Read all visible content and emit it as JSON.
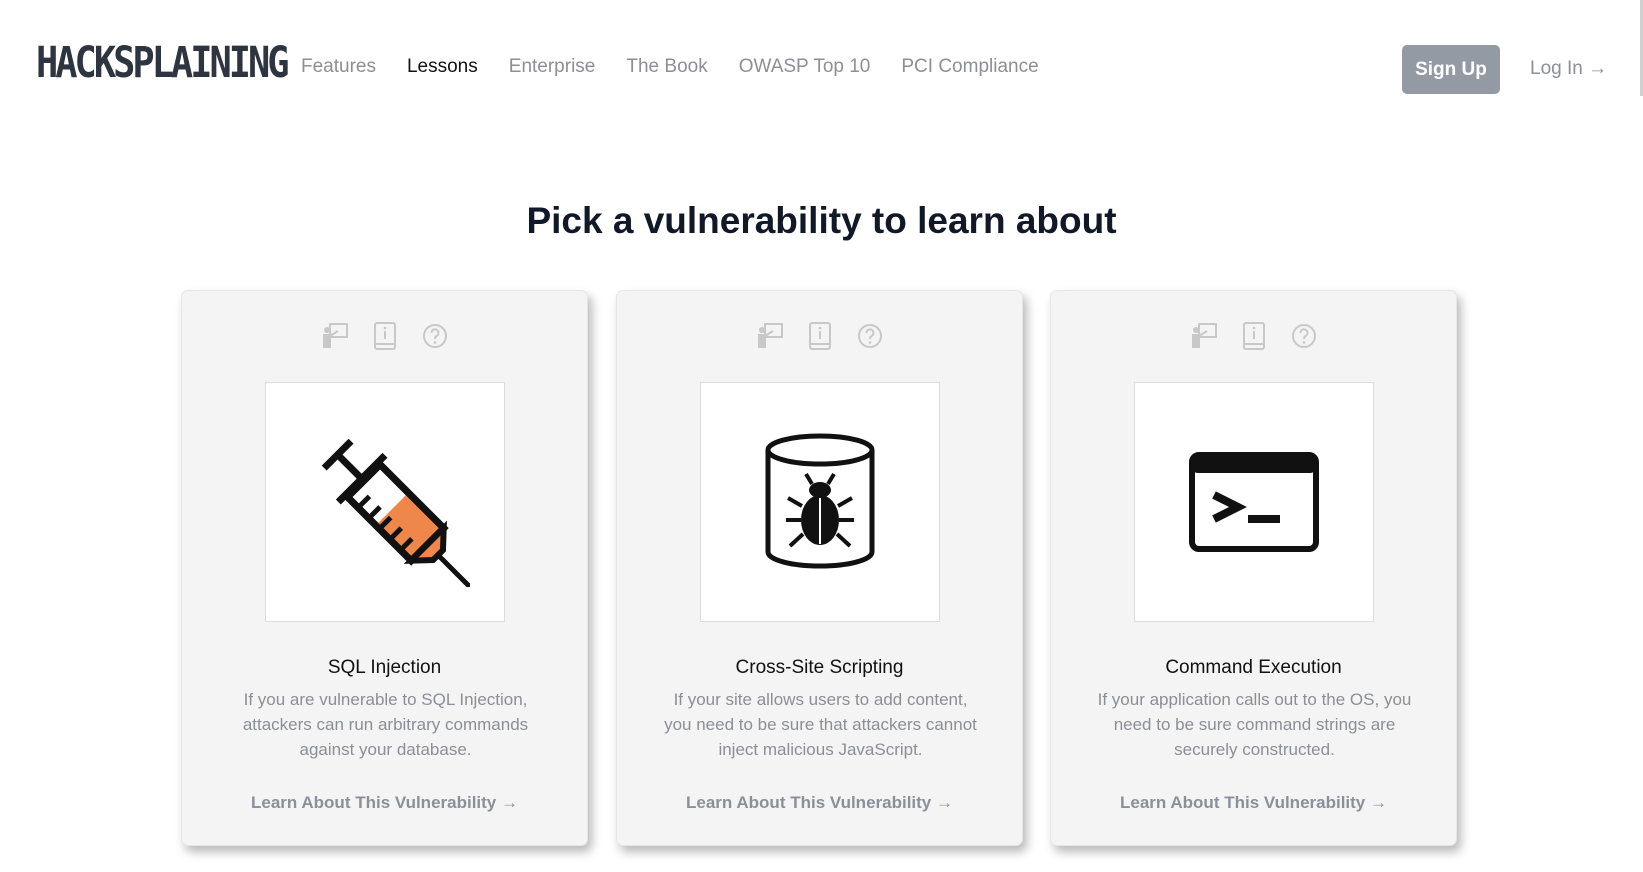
{
  "header": {
    "logo": "HACKSPLAINING",
    "nav": [
      "Features",
      "Lessons",
      "Enterprise",
      "The Book",
      "OWASP Top 10",
      "PCI Compliance"
    ],
    "active_nav": "Lessons",
    "signup_label": "Sign Up",
    "login_label": "Log In →"
  },
  "page_title": "Pick a vulnerability to learn about",
  "cards": [
    {
      "title": "SQL Injection",
      "description": "If you are vulnerable to SQL Injection, attackers can run arbitrary commands against your database.",
      "link": "Learn About This Vulnerability →",
      "image_icon": "syringe-icon"
    },
    {
      "title": "Cross-Site Scripting",
      "description": "If your site allows users to add content, you need to be sure that attackers cannot inject malicious JavaScript.",
      "link": "Learn About This Vulnerability →",
      "image_icon": "bug-in-jar-icon"
    },
    {
      "title": "Command Execution",
      "description": "If your application calls out to the OS, you need to be sure command strings are securely constructed.",
      "link": "Learn About This Vulnerability →",
      "image_icon": "terminal-icon"
    }
  ],
  "card_mini_icons": [
    "presenter-icon",
    "book-info-icon",
    "question-icon"
  ],
  "colors": {
    "signup_bg": "#949aa3",
    "card_bg": "#f4f4f4",
    "syringe_fill": "#f0874a"
  }
}
